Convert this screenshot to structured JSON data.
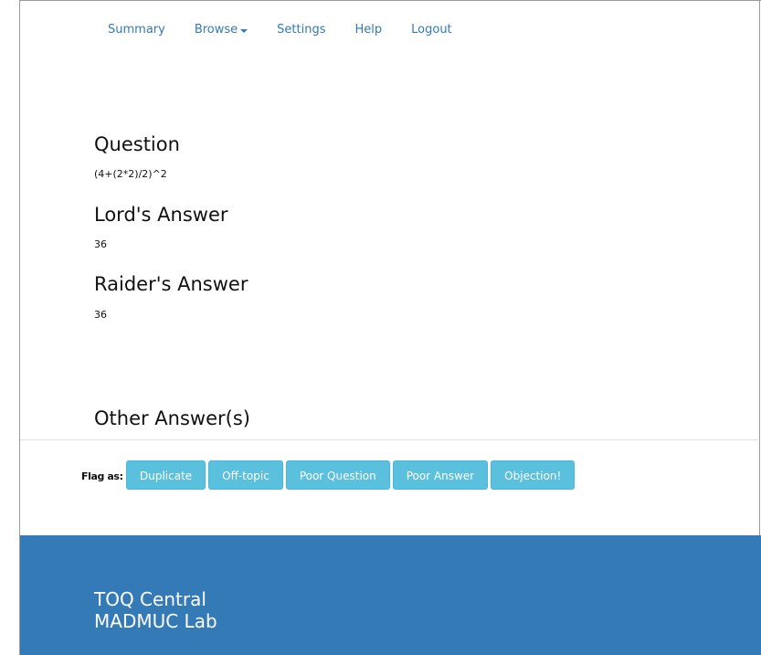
{
  "nav": {
    "items": [
      {
        "label": "Summary"
      },
      {
        "label": "Browse"
      },
      {
        "label": "Settings"
      },
      {
        "label": "Help"
      },
      {
        "label": "Logout"
      }
    ]
  },
  "question": {
    "heading": "Question",
    "value": "(4+(2*2)/2)^2"
  },
  "lord_answer": {
    "heading": "Lord's Answer",
    "value": "36"
  },
  "raider_answer": {
    "heading": "Raider's Answer",
    "value": "36"
  },
  "other_answers": {
    "heading": "Other Answer(s)"
  },
  "flag": {
    "label": "Flag as:",
    "buttons": [
      {
        "label": "Duplicate"
      },
      {
        "label": "Off-topic"
      },
      {
        "label": "Poor Question"
      },
      {
        "label": "Poor Answer"
      },
      {
        "label": "Objection!"
      }
    ]
  },
  "footer": {
    "line1": "TOQ Central",
    "line2": "MADMUC Lab"
  },
  "colors": {
    "link": "#337ab7",
    "flag_button": "#5bc0de",
    "footer_bg": "#337ab7"
  }
}
